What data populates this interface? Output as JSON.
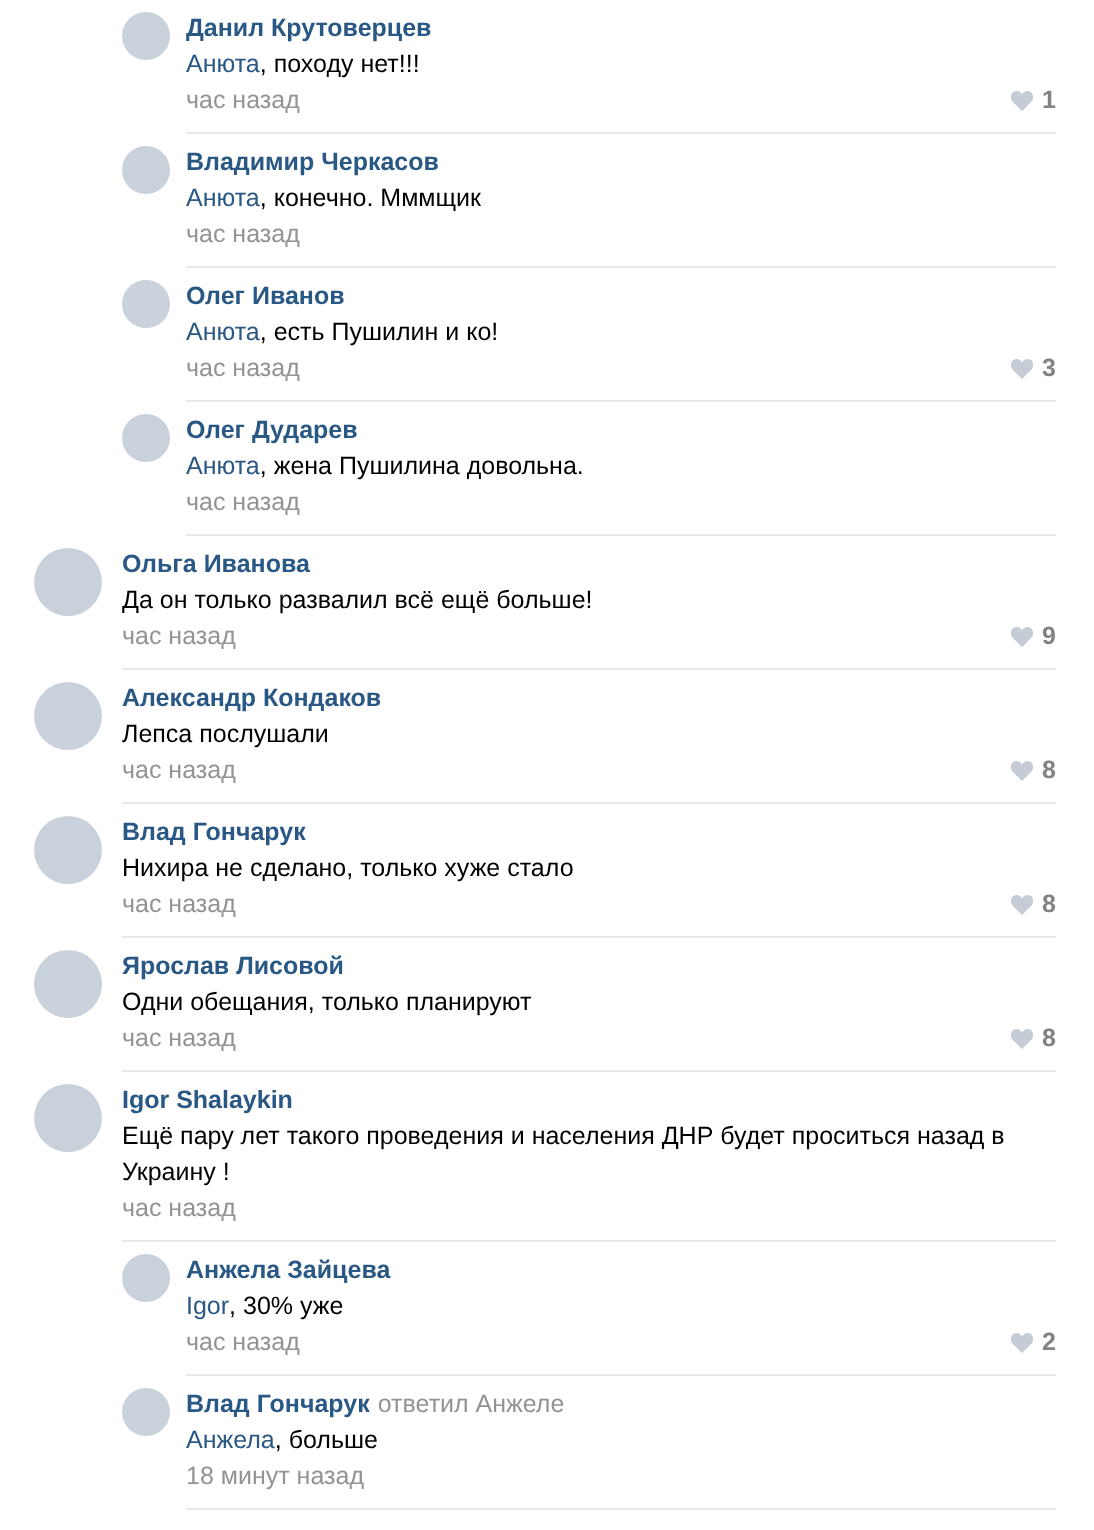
{
  "replies_above": [
    {
      "author": "Данил Крутоверцев",
      "mention": "Анюта",
      "text": ", походу нет!!!",
      "time": "час назад",
      "likes": "1"
    },
    {
      "author": "Владимир Черкасов",
      "mention": "Анюта",
      "text": ", конечно. Мммщик",
      "time": "час назад"
    },
    {
      "author": "Олег Иванов",
      "mention": "Анюта",
      "text": ", есть Пушилин и ко!",
      "time": "час назад",
      "likes": "3"
    },
    {
      "author": "Олег Дударев",
      "mention": "Анюта",
      "text": ", жена Пушилина довольна.",
      "time": "час назад"
    }
  ],
  "comments": [
    {
      "author": "Ольга Иванова",
      "text": "Да он только развалил всё ещё больше!",
      "time": "час назад",
      "likes": "9"
    },
    {
      "author": "Александр Кондаков",
      "text": "Лепса послушали",
      "time": "час назад",
      "likes": "8"
    },
    {
      "author": "Влад Гончарук",
      "text": "Нихира не сделано, только хуже стало",
      "time": "час назад",
      "likes": "8"
    },
    {
      "author": "Ярослав Лисовой",
      "text": "Одни обещания, только планируют",
      "time": "час назад",
      "likes": "8"
    },
    {
      "author": "Igor Shalaykin",
      "text": "Ещё пару лет такого проведения и населения ДНР будет проситься назад в Украину !",
      "time": "час назад",
      "children": [
        {
          "author": "Анжела Зайцева",
          "mention": "Igor",
          "text": ", 30% уже",
          "time": "час назад",
          "likes": "2"
        },
        {
          "author": "Влад Гончарук",
          "reply_note": "ответил Анжеле",
          "mention": "Анжела",
          "text": ", больше",
          "time": "18 минут назад"
        }
      ]
    }
  ]
}
